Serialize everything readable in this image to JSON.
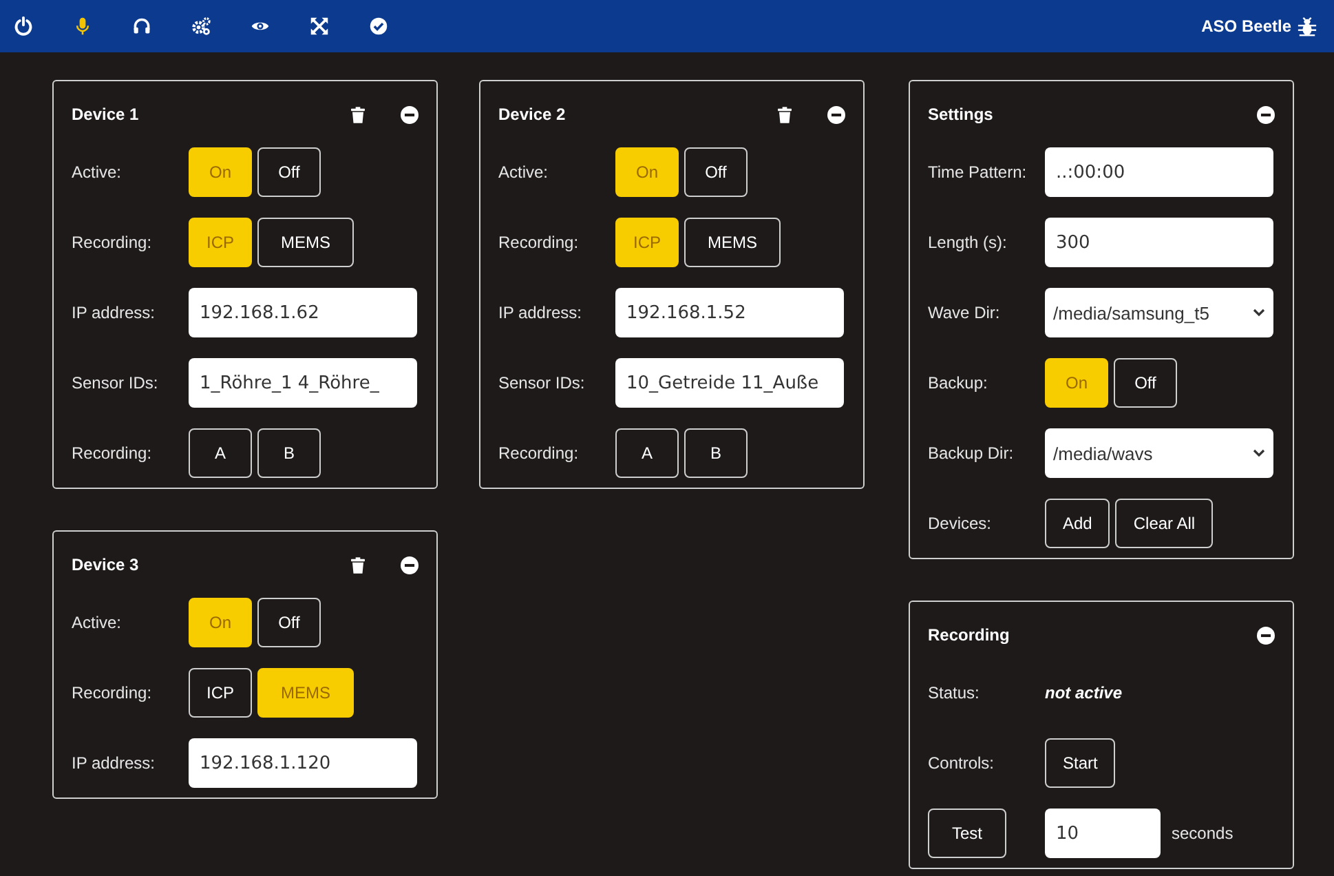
{
  "toolbar": {
    "icons": [
      {
        "kind": "power",
        "selected": false
      },
      {
        "kind": "microphone",
        "selected": true
      },
      {
        "kind": "headphones",
        "selected": false
      },
      {
        "kind": "gears",
        "selected": false
      },
      {
        "kind": "eye",
        "selected": false
      },
      {
        "kind": "arrows",
        "selected": false
      },
      {
        "kind": "check",
        "selected": false
      }
    ],
    "brand": "ASO Beetle"
  },
  "columns": [
    [
      {
        "title": "Device 1",
        "removable": true,
        "rows": [
          {
            "kind": "toggle",
            "label": "Active:",
            "options": [
              {
                "label": "On",
                "selected": true
              },
              {
                "label": "Off",
                "selected": false
              }
            ]
          },
          {
            "kind": "toggle",
            "label": "Recording:",
            "options": [
              {
                "label": "ICP",
                "selected": true
              },
              {
                "label": "MEMS",
                "selected": false
              }
            ]
          },
          {
            "kind": "input",
            "label": "IP address:",
            "value": "192.168.1.62"
          },
          {
            "kind": "input",
            "label": "Sensor IDs:",
            "value": "1_Röhre_1 4_Röhre_"
          },
          {
            "kind": "buttons",
            "label": "Recording:",
            "buttons": [
              "A",
              "B"
            ]
          }
        ]
      },
      {
        "title": "Device 3",
        "removable": true,
        "rows": [
          {
            "kind": "toggle",
            "label": "Active:",
            "options": [
              {
                "label": "On",
                "selected": true
              },
              {
                "label": "Off",
                "selected": false
              }
            ]
          },
          {
            "kind": "toggle",
            "label": "Recording:",
            "options": [
              {
                "label": "ICP",
                "selected": false
              },
              {
                "label": "MEMS",
                "selected": true
              }
            ]
          },
          {
            "kind": "input",
            "label": "IP address:",
            "value": "192.168.1.120"
          }
        ]
      }
    ],
    [
      {
        "title": "Device 2",
        "removable": true,
        "rows": [
          {
            "kind": "toggle",
            "label": "Active:",
            "options": [
              {
                "label": "On",
                "selected": true
              },
              {
                "label": "Off",
                "selected": false
              }
            ]
          },
          {
            "kind": "toggle",
            "label": "Recording:",
            "options": [
              {
                "label": "ICP",
                "selected": true
              },
              {
                "label": "MEMS",
                "selected": false
              }
            ]
          },
          {
            "kind": "input",
            "label": "IP address:",
            "value": "192.168.1.52"
          },
          {
            "kind": "input",
            "label": "Sensor IDs:",
            "value": "10_Getreide 11_Auße"
          },
          {
            "kind": "buttons",
            "label": "Recording:",
            "buttons": [
              "A",
              "B"
            ]
          }
        ]
      }
    ],
    [
      {
        "title": "Settings",
        "removable": false,
        "rows": [
          {
            "kind": "input",
            "label": "Time Pattern:",
            "value": "..:00:00"
          },
          {
            "kind": "input",
            "label": "Length (s):",
            "value": "300"
          },
          {
            "kind": "select",
            "label": "Wave Dir:",
            "value": "/media/samsung_t5"
          },
          {
            "kind": "toggle",
            "label": "Backup:",
            "options": [
              {
                "label": "On",
                "selected": true
              },
              {
                "label": "Off",
                "selected": false
              }
            ]
          },
          {
            "kind": "select",
            "label": "Backup Dir:",
            "value": "/media/wavs"
          },
          {
            "kind": "buttons",
            "label": "Devices:",
            "buttons": [
              "Add",
              "Clear All"
            ]
          }
        ]
      },
      {
        "title": "Recording",
        "removable": false,
        "rows": [
          {
            "kind": "status",
            "label": "Status:",
            "value": "not active"
          },
          {
            "kind": "buttons",
            "label": "Controls:",
            "buttons": [
              "Start"
            ]
          },
          {
            "kind": "test",
            "button": "Test",
            "value": "10",
            "unit": "seconds"
          }
        ]
      }
    ]
  ]
}
